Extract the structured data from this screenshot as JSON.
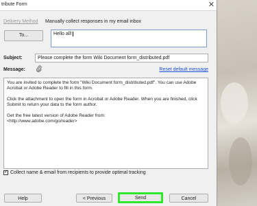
{
  "window": {
    "title": "tribute Form",
    "close_glyph": "✕"
  },
  "delivery": {
    "tab_label": "Delivery Method",
    "description": "Manually collect responses in my email inbox"
  },
  "to": {
    "button_label": "To...",
    "value": "Hello all!"
  },
  "subject": {
    "label": "Subject:",
    "value": "Please complete the form Wiki Document form_distributed.pdf"
  },
  "message": {
    "label": "Message:",
    "attach_icon": "paperclip-icon",
    "reset_label": "Reset default message",
    "paragraphs": [
      "You are invited to complete the form \"Wiki Document form_distributed.pdf\". You can use Adobe Acrobat or Adobe Reader to fill in this form.",
      "Click the attachment to open the form in Acrobat or Adobe Reader. When you are finished, click Submit to return your data to the form author.",
      "Get the free latest version of Adobe Reader from:\n<http://www.adobe.com/go/reader>"
    ]
  },
  "collect": {
    "checked": true,
    "label": "Collect name & email from recipients to provide optimal tracking"
  },
  "buttons": {
    "help": "Help",
    "previous": "< Previous",
    "send": "Send",
    "cancel": "Cancel"
  },
  "colors": {
    "highlight": "#2ee82e",
    "link": "#1a4fd6"
  }
}
